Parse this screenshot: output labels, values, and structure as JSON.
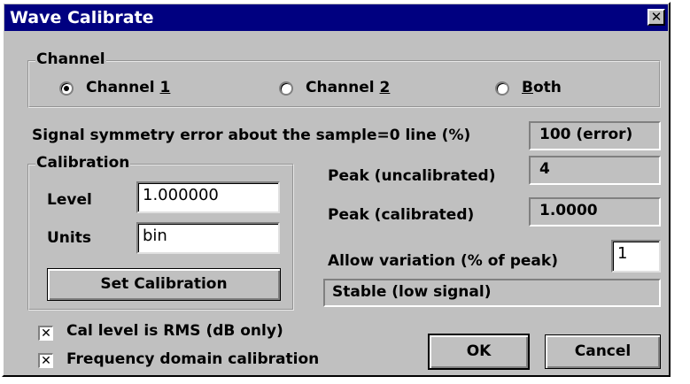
{
  "window": {
    "title": "Wave Calibrate",
    "close_glyph": "✕"
  },
  "channel": {
    "legend": "Channel",
    "options": [
      {
        "prefix": "Channel ",
        "accel": "1",
        "suffix": "",
        "selected": true
      },
      {
        "prefix": "Channel ",
        "accel": "2",
        "suffix": "",
        "selected": false
      },
      {
        "prefix": "",
        "accel": "B",
        "suffix": "oth",
        "selected": false
      }
    ]
  },
  "symmetry": {
    "label": "Signal symmetry error about the sample=0 line (%)",
    "value": "100 (error)"
  },
  "calibration": {
    "legend": "Calibration",
    "level_label": "Level",
    "level_value": "1.000000",
    "units_label": "Units",
    "units_value": "bin",
    "set_button": "Set Calibration"
  },
  "peak_uncal": {
    "label": "Peak (uncalibrated)",
    "value": "4"
  },
  "peak_cal": {
    "label": "Peak (calibrated)",
    "value": "1.0000"
  },
  "variation": {
    "label": "Allow variation (% of peak)",
    "value": "1"
  },
  "status": {
    "text": "Stable (low signal)"
  },
  "options": [
    {
      "label": "Cal level is RMS (dB only)",
      "checked": true,
      "mark": "✕"
    },
    {
      "label": "Frequency domain calibration",
      "checked": true,
      "mark": "✕"
    }
  ],
  "buttons": {
    "ok": "OK",
    "cancel": "Cancel"
  }
}
